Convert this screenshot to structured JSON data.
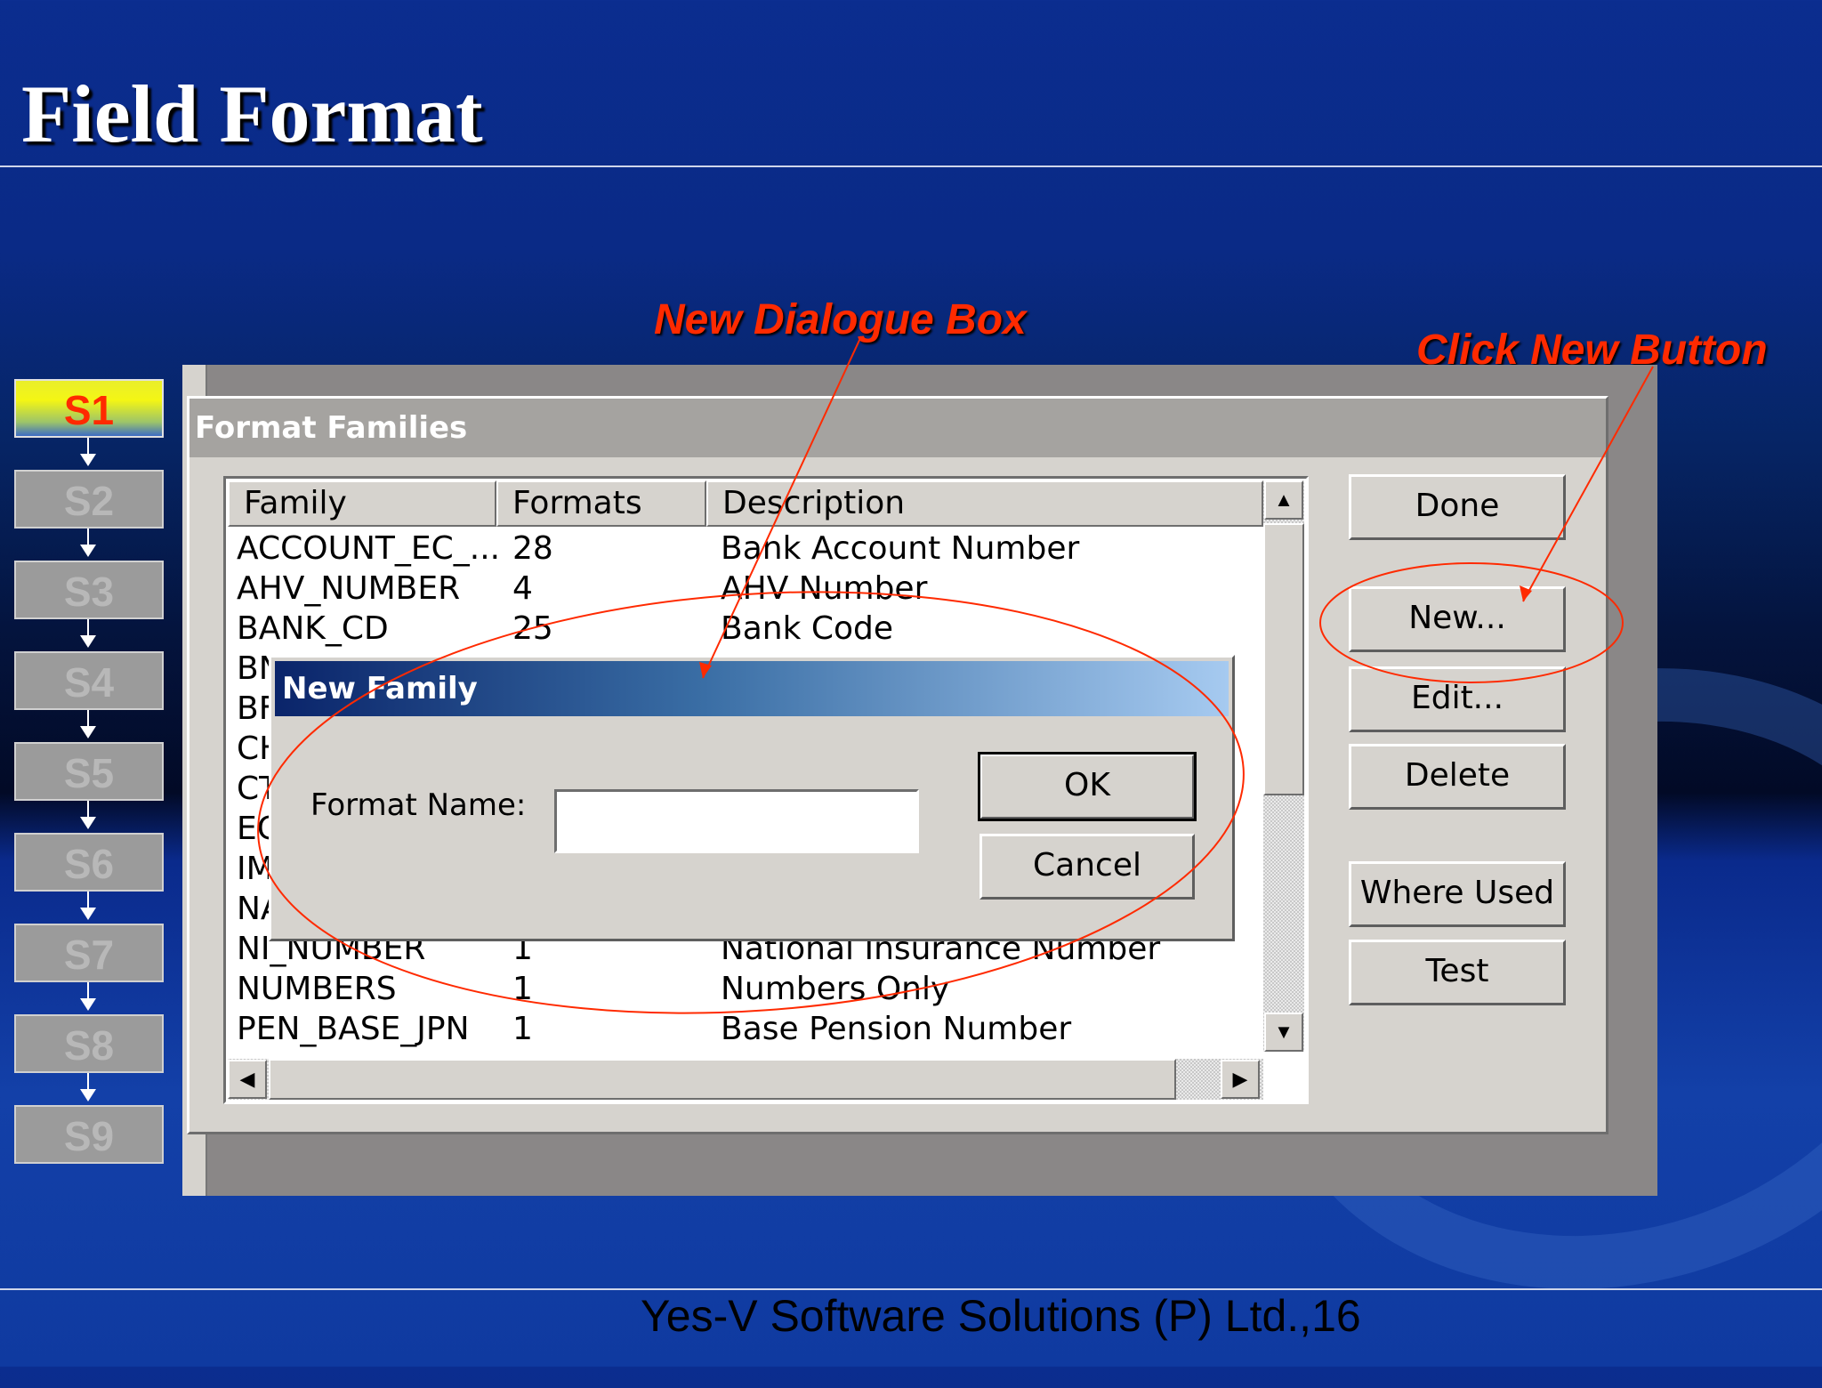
{
  "slide": {
    "title": "Field Format",
    "footer": "Yes-V Software Solutions (P) Ltd.,16",
    "callout_dialog": "New Dialogue Box",
    "callout_new_button": "Click New Button",
    "steps": [
      "S1",
      "S2",
      "S3",
      "S4",
      "S5",
      "S6",
      "S7",
      "S8",
      "S9"
    ],
    "active_step": "S1"
  },
  "window": {
    "title": "Format Families",
    "columns": [
      "Family",
      "Formats",
      "Description"
    ],
    "rows": [
      {
        "family": "ACCOUNT_EC_...",
        "formats": "28",
        "description": "Bank Account Number"
      },
      {
        "family": "AHV_NUMBER",
        "formats": "4",
        "description": "AHV Number"
      },
      {
        "family": "BANK_CD",
        "formats": "25",
        "description": "Bank Code"
      },
      {
        "family": "BN",
        "formats": "",
        "description": ""
      },
      {
        "family": "BF",
        "formats": "",
        "description": ""
      },
      {
        "family": "CH",
        "formats": "",
        "description": ""
      },
      {
        "family": "CT",
        "formats": "",
        "description": ""
      },
      {
        "family": "EC",
        "formats": "",
        "description": ""
      },
      {
        "family": "IM",
        "formats": "",
        "description": ""
      },
      {
        "family": "NA",
        "formats": "",
        "description": ""
      },
      {
        "family": "NI_NUMBER",
        "formats": "1",
        "description": "National Insurance Number"
      },
      {
        "family": "NUMBERS",
        "formats": "1",
        "description": "Numbers Only"
      },
      {
        "family": "PEN_BASE_JPN",
        "formats": "1",
        "description": "Base Pension Number"
      }
    ],
    "buttons": {
      "done": "Done",
      "new": "New...",
      "edit": "Edit...",
      "delete": "Delete",
      "where_used": "Where Used",
      "test": "Test"
    }
  },
  "dialog": {
    "title": "New Family",
    "label": "Format Name:",
    "input_value": "",
    "ok": "OK",
    "cancel": "Cancel"
  },
  "colors": {
    "callout": "#ff2a00",
    "active_step_text": "#ff2a00",
    "dialog_title_start": "#0a246a",
    "dialog_title_end": "#a6caf0"
  }
}
